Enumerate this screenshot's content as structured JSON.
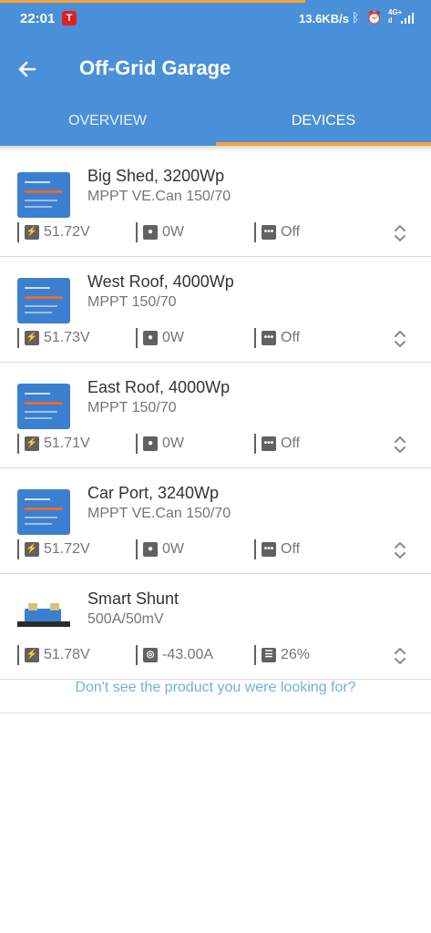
{
  "status_bar": {
    "time": "22:01",
    "speed": "13.6KB/s",
    "network_top": "4G+",
    "network_bottom": "ıl"
  },
  "header": {
    "title": "Off-Grid Garage",
    "tabs": [
      {
        "label": "OVERVIEW",
        "active": false
      },
      {
        "label": "DEVICES",
        "active": true
      }
    ]
  },
  "devices": [
    {
      "name": "Big Shed, 3200Wp",
      "model": "MPPT VE.Can 150/70",
      "voltage": "51.72V",
      "power": "0W",
      "state": "Off"
    },
    {
      "name": "West Roof, 4000Wp",
      "model": "MPPT 150/70",
      "voltage": "51.73V",
      "power": "0W",
      "state": "Off"
    },
    {
      "name": "East Roof, 4000Wp",
      "model": "MPPT 150/70",
      "voltage": "51.71V",
      "power": "0W",
      "state": "Off"
    },
    {
      "name": "Car Port, 3240Wp",
      "model": "MPPT VE.Can 150/70",
      "voltage": "51.72V",
      "power": "0W",
      "state": "Off"
    },
    {
      "name": "Smart Shunt",
      "model": "500A/50mV",
      "voltage": "51.78V",
      "current": "-43.00A",
      "soc": "26%"
    }
  ],
  "footer": {
    "link": "Don't see the product you were looking for?"
  },
  "colors": {
    "primary": "#4a90d9",
    "accent": "#f5a13a",
    "link": "#74aee0"
  }
}
